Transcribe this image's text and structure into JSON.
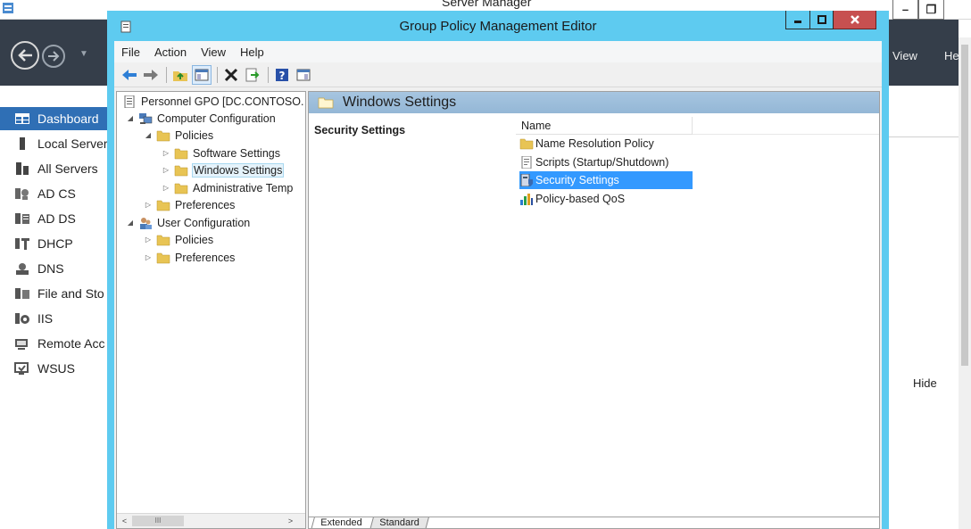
{
  "server_manager": {
    "title": "Server Manager",
    "menu": {
      "view": "View",
      "help": "He"
    },
    "nav_items": [
      {
        "label": "Dashboard",
        "icon": "dashboard-icon",
        "active": true
      },
      {
        "label": "Local Server",
        "icon": "server-icon",
        "active": false
      },
      {
        "label": "All Servers",
        "icon": "servers-icon",
        "active": false
      },
      {
        "label": "AD CS",
        "icon": "ad-cs-icon",
        "active": false
      },
      {
        "label": "AD DS",
        "icon": "ad-ds-icon",
        "active": false
      },
      {
        "label": "DHCP",
        "icon": "dhcp-icon",
        "active": false
      },
      {
        "label": "DNS",
        "icon": "dns-icon",
        "active": false
      },
      {
        "label": "File and Sto",
        "icon": "file-storage-icon",
        "active": false
      },
      {
        "label": "IIS",
        "icon": "iis-icon",
        "active": false
      },
      {
        "label": "Remote Acc",
        "icon": "remote-access-icon",
        "active": false
      },
      {
        "label": "WSUS",
        "icon": "wsus-icon",
        "active": false
      }
    ],
    "hide_label": "Hide",
    "accent": "#2f6fb5",
    "header_color": "#353e4a"
  },
  "gpme": {
    "title": "Group Policy Management Editor",
    "menu": [
      "File",
      "Action",
      "View",
      "Help"
    ],
    "toolbar": [
      "back-icon",
      "forward-icon",
      "up-folder-icon",
      "show-hide-tree-icon",
      "delete-icon",
      "export-list-icon",
      "help-icon",
      "properties-icon"
    ],
    "tree": {
      "root": "Personnel GPO [DC.CONTOSO.",
      "computer_config": "Computer Configuration",
      "policies": "Policies",
      "software_settings": "Software Settings",
      "windows_settings": "Windows Settings",
      "admin_templates": "Administrative Temp",
      "preferences": "Preferences",
      "user_config": "User Configuration",
      "user_policies": "Policies",
      "user_preferences": "Preferences"
    },
    "detail": {
      "header_title": "Windows Settings",
      "left_title": "Security Settings",
      "column_name": "Name",
      "items": [
        {
          "label": "Name Resolution Policy",
          "icon": "folder-icon",
          "selected": false
        },
        {
          "label": "Scripts (Startup/Shutdown)",
          "icon": "script-icon",
          "selected": false
        },
        {
          "label": "Security Settings",
          "icon": "security-settings-icon",
          "selected": true
        },
        {
          "label": "Policy-based QoS",
          "icon": "qos-chart-icon",
          "selected": false
        }
      ],
      "tabs": [
        "Extended",
        "Standard"
      ]
    },
    "frame_color": "#5ecbf0",
    "selection_color": "#3399ff"
  }
}
